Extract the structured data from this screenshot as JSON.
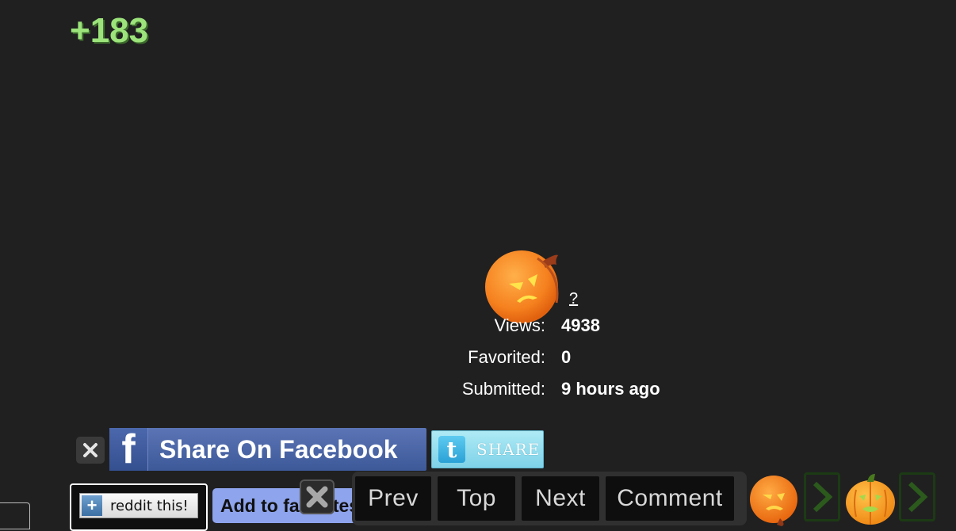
{
  "score": "+183",
  "help_link": "?",
  "stats": {
    "views_label": "Views:",
    "views_value": "4938",
    "favorited_label": "Favorited:",
    "favorited_value": "0",
    "submitted_label": "Submitted:",
    "submitted_value": "9 hours ago"
  },
  "share": {
    "facebook_logo": "f",
    "facebook_label": "Share On Facebook",
    "twitter_logo": "t",
    "twitter_label": "SHARE",
    "reddit_label": "reddit this!",
    "favorites_label": "Add to favorites"
  },
  "nav": {
    "prev": "Prev",
    "top": "Top",
    "next": "Next",
    "comment": "Comment"
  },
  "colors": {
    "background": "#202021",
    "score_green": "#9be37a",
    "facebook_blue": "#3d5998",
    "twitter_blue": "#8fdaee",
    "favorites_blue": "#8ea4ec",
    "pumpkin_orange": "#f58a24"
  },
  "icons": {
    "main": "angry-pumpkin-icon",
    "downvote": "angry-pumpkin-icon",
    "upvote": "jack-o-lantern-icon",
    "arrow": "chevron-right-icon",
    "close": "close-icon"
  }
}
